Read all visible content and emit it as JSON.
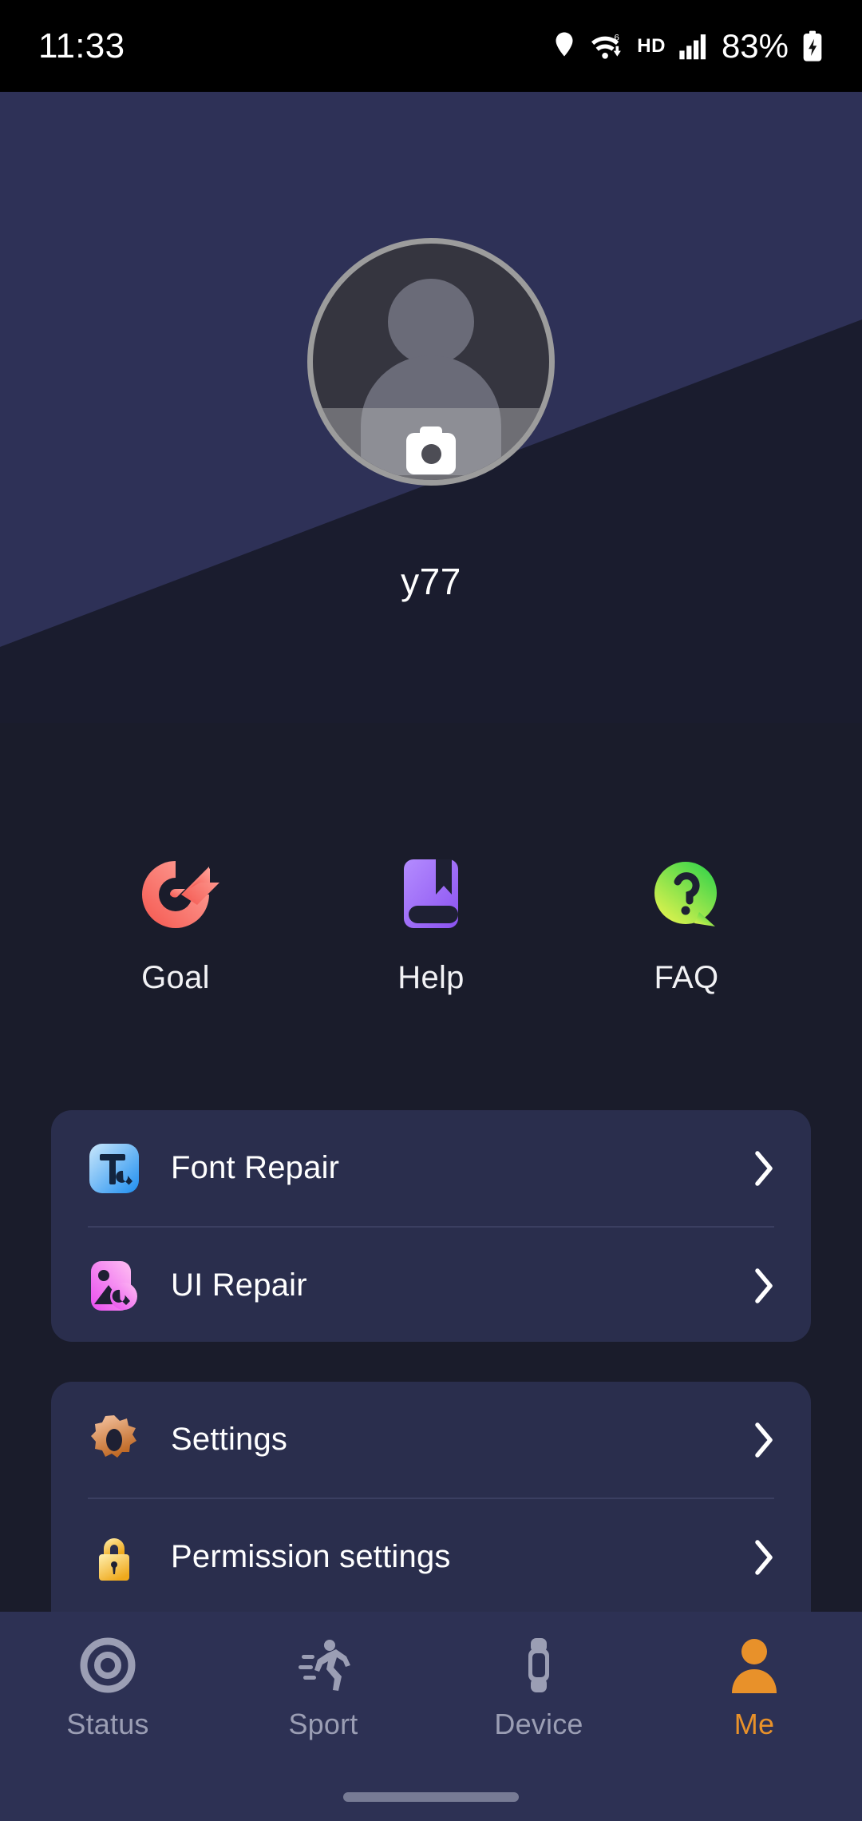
{
  "status_bar": {
    "time": "11:33",
    "hd_label": "HD",
    "battery_text": "83%",
    "icons": [
      "location-pin-icon",
      "wifi-6-icon",
      "hd-icon",
      "cellular-signal-icon",
      "battery-charging-icon"
    ]
  },
  "profile": {
    "username": "y77",
    "avatar_icon": "default-person-avatar",
    "camera_button_icon": "camera-icon",
    "colors": {
      "header_top": "#2e3157",
      "header_bottom": "#1a1c2e",
      "avatar_border": "#9c9c9c",
      "avatar_fill": "#35353f"
    }
  },
  "shortcuts": [
    {
      "label": "Goal",
      "icon": "target-arrow-icon",
      "color": "#f8655c"
    },
    {
      "label": "Help",
      "icon": "book-bookmark-icon",
      "color": "#a273f7"
    },
    {
      "label": "FAQ",
      "icon": "question-speech-bubble-icon",
      "color": "#4bd14b"
    }
  ],
  "cards": [
    {
      "rows": [
        {
          "label": "Font Repair",
          "icon": "font-repair-icon",
          "color": "#3aa7f5",
          "chevron": "chevron-right-icon"
        },
        {
          "label": "UI Repair",
          "icon": "ui-repair-icon",
          "color": "#ef6cf0",
          "chevron": "chevron-right-icon"
        }
      ]
    },
    {
      "rows": [
        {
          "label": "Settings",
          "icon": "gear-icon",
          "color": "#d98a52",
          "chevron": "chevron-right-icon"
        },
        {
          "label": "Permission settings",
          "icon": "padlock-icon",
          "color": "#f5c431",
          "chevron": "chevron-right-icon"
        }
      ]
    }
  ],
  "bottom_nav": {
    "active_color": "#e8912a",
    "inactive_color": "#9b9eb4",
    "items": [
      {
        "label": "Status",
        "icon": "rings-status-icon",
        "active": false
      },
      {
        "label": "Sport",
        "icon": "running-person-icon",
        "active": false
      },
      {
        "label": "Device",
        "icon": "smartwatch-icon",
        "active": false
      },
      {
        "label": "Me",
        "icon": "person-icon",
        "active": true
      }
    ]
  }
}
